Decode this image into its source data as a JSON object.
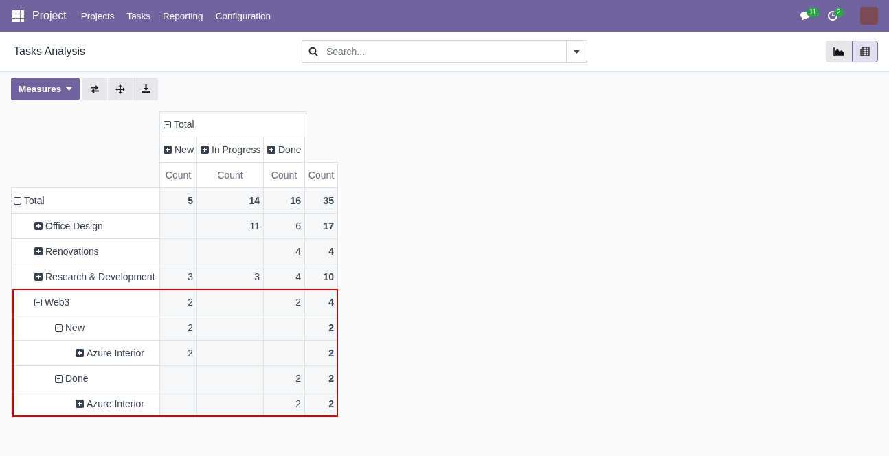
{
  "navbar": {
    "app_name": "Project",
    "menu": [
      "Projects",
      "Tasks",
      "Reporting",
      "Configuration"
    ],
    "messages_badge": "11",
    "activities_badge": "2"
  },
  "control_panel": {
    "title": "Tasks Analysis",
    "search": {
      "placeholder": "Search..."
    },
    "views": [
      {
        "kind": "graph",
        "selected": false
      },
      {
        "kind": "pivot",
        "selected": true
      }
    ]
  },
  "toolbar": {
    "measures_button": "Measures"
  },
  "pivot": {
    "column_group": {
      "label": "Total",
      "expanded": true
    },
    "columns": [
      {
        "label": "New",
        "expanded": false
      },
      {
        "label": "In Progress",
        "expanded": false
      },
      {
        "label": "Done",
        "expanded": false
      }
    ],
    "measures": [
      "Count",
      "Count",
      "Count",
      "Count"
    ],
    "rows": [
      {
        "label": "Total",
        "expanded": true,
        "highlighted": false,
        "values": {
          "new": "5",
          "in_progress": "14",
          "done": "16",
          "total": "35"
        },
        "children": [
          {
            "label": "Office Design",
            "expanded": false,
            "highlighted": false,
            "values": {
              "in_progress": "11",
              "done": "6",
              "total": "17"
            }
          },
          {
            "label": "Renovations",
            "expanded": false,
            "highlighted": false,
            "values": {
              "done": "4",
              "total": "4"
            }
          },
          {
            "label": "Research & Development",
            "expanded": false,
            "highlighted": false,
            "values": {
              "new": "3",
              "in_progress": "3",
              "done": "4",
              "total": "10"
            }
          },
          {
            "label": "Web3",
            "expanded": true,
            "highlighted": true,
            "values": {
              "new": "2",
              "done": "2",
              "total": "4"
            },
            "children": [
              {
                "label": "New",
                "expanded": true,
                "highlighted": false,
                "values": {
                  "new": "2",
                  "total": "2"
                },
                "children": [
                  {
                    "label": "Azure Interior",
                    "expanded": false,
                    "highlighted": false,
                    "values": {
                      "new": "2",
                      "total": "2"
                    }
                  }
                ]
              },
              {
                "label": "Done",
                "expanded": true,
                "highlighted": false,
                "values": {
                  "done": "2",
                  "total": "2"
                },
                "children": [
                  {
                    "label": "Azure Interior",
                    "expanded": false,
                    "highlighted": false,
                    "values": {
                      "done": "2",
                      "total": "2"
                    }
                  }
                ]
              }
            ]
          }
        ]
      }
    ]
  }
}
